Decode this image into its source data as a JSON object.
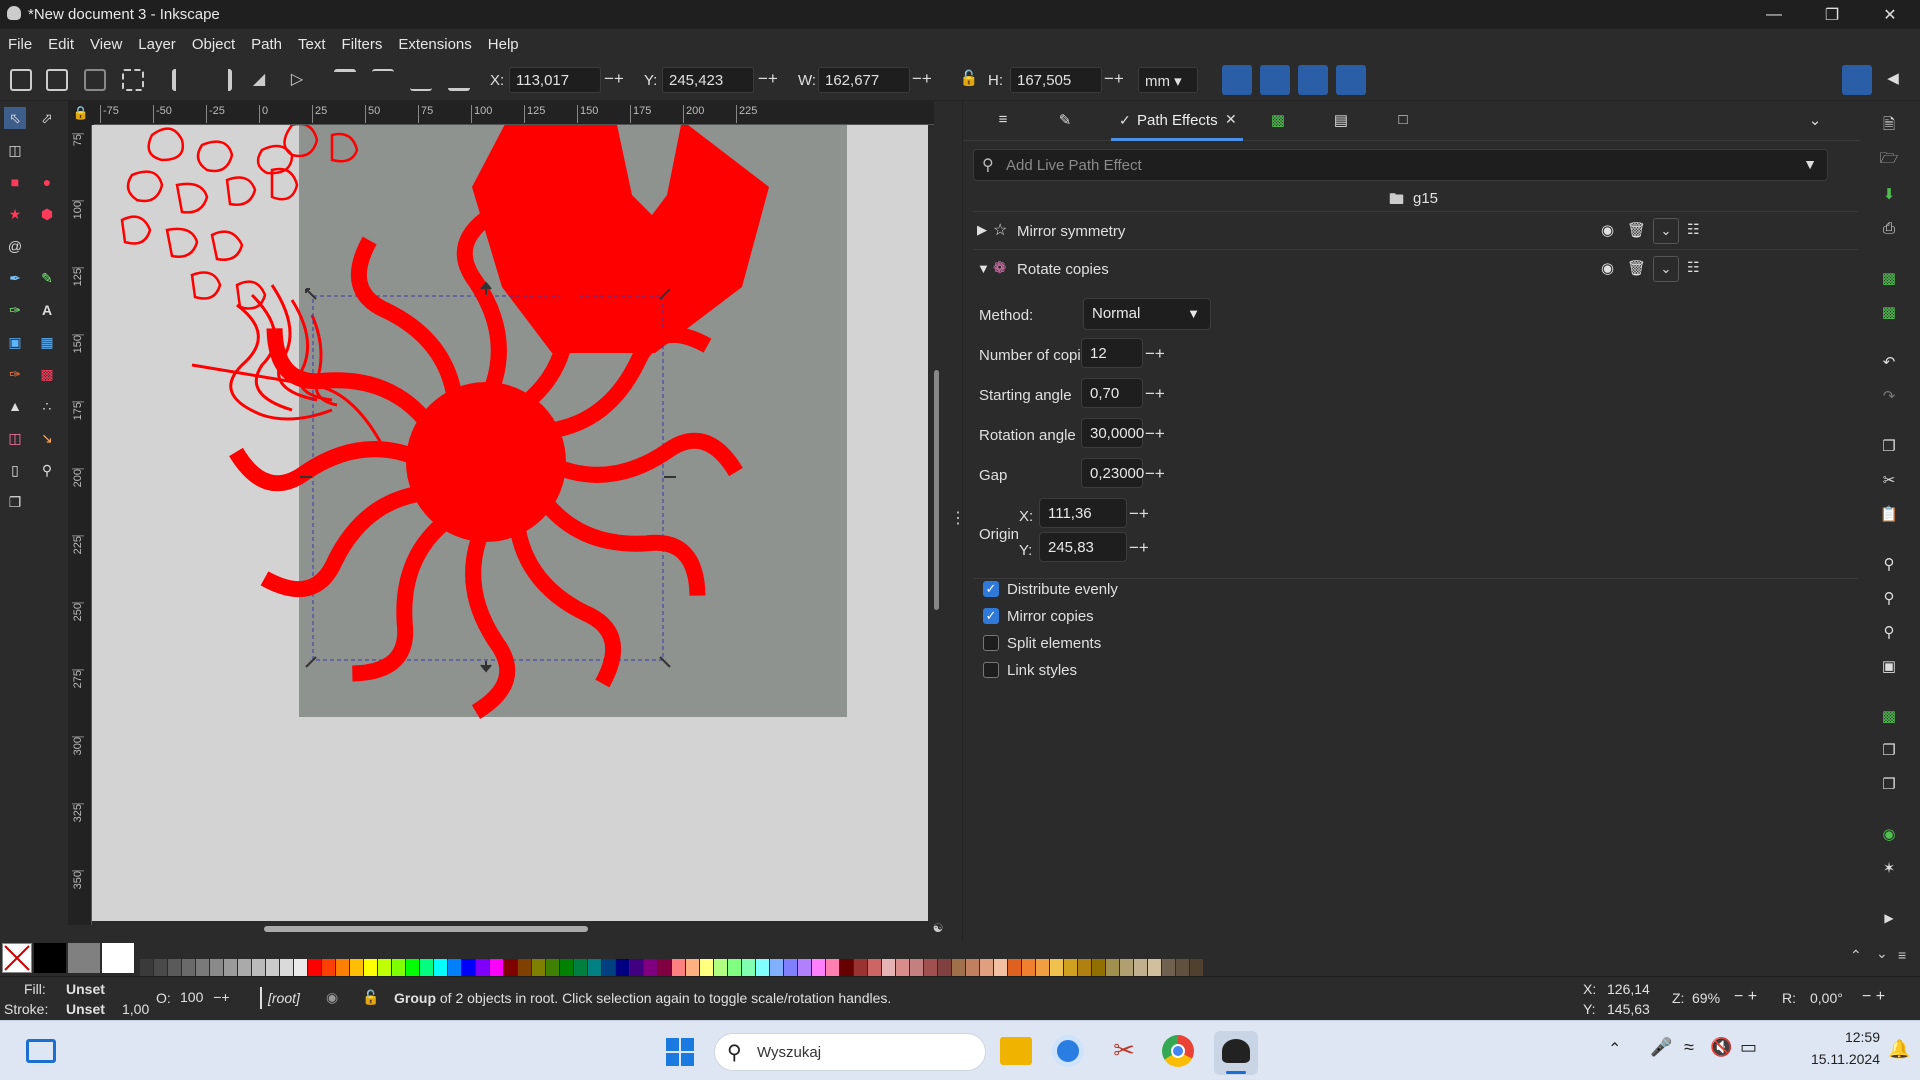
{
  "window": {
    "title": "*New document 3 - Inkscape"
  },
  "menu": [
    "File",
    "Edit",
    "View",
    "Layer",
    "Object",
    "Path",
    "Text",
    "Filters",
    "Extensions",
    "Help"
  ],
  "toolbar": {
    "x_label": "X:",
    "x_value": "113,017",
    "y_label": "Y:",
    "y_value": "245,423",
    "w_label": "W:",
    "w_value": "162,677",
    "h_label": "H:",
    "h_value": "167,505",
    "unit": "mm"
  },
  "ruler": {
    "top_ticks": [
      "-75",
      "-50",
      "-25",
      "0",
      "25",
      "50",
      "75",
      "100",
      "125",
      "150",
      "175",
      "200",
      "225"
    ],
    "left_ticks": [
      "75",
      "100",
      "125",
      "150",
      "175",
      "200",
      "225",
      "250",
      "275",
      "300",
      "325",
      "350"
    ]
  },
  "panel": {
    "tab_active": "Path Effects",
    "search_placeholder": "Add Live Path Effect",
    "object_name": "g15",
    "effects": [
      {
        "name": "Mirror symmetry"
      },
      {
        "name": "Rotate copies"
      }
    ],
    "params": {
      "method_label": "Method:",
      "method_value": "Normal",
      "copies_label": "Number of copies",
      "copies_value": "12",
      "start_label": "Starting angle",
      "start_value": "0,70",
      "rot_label": "Rotation angle",
      "rot_value": "30,0000",
      "gap_label": "Gap",
      "gap_value": "0,23000",
      "origin_label": "Origin",
      "ox_label": "X:",
      "ox_value": "111,36",
      "oy_label": "Y:",
      "oy_value": "245,83"
    },
    "checks": [
      {
        "label": "Distribute evenly",
        "checked": true
      },
      {
        "label": "Mirror copies",
        "checked": true
      },
      {
        "label": "Split elements",
        "checked": false
      },
      {
        "label": "Link styles",
        "checked": false
      }
    ]
  },
  "status": {
    "fill_label": "Fill:",
    "fill_value": "Unset",
    "stroke_label": "Stroke:",
    "stroke_value": "Unset",
    "stroke_width": "1,00",
    "opacity_label": "O:",
    "opacity_value": "100",
    "layer": "[root]",
    "message_bold": "Group",
    "message_rest": " of 2 objects in root. Click selection again to toggle scale/rotation handles.",
    "cx_label": "X:",
    "cx_value": "126,14",
    "cy_label": "Y:",
    "cy_value": "145,63",
    "zoom_label": "Z:",
    "zoom_value": "69%",
    "rot_label": "R:",
    "rot_value": "0,00°"
  },
  "taskbar": {
    "search_placeholder": "Wyszukaj",
    "time": "12:59",
    "date": "15.11.2024"
  },
  "palette": [
    "#ff0000",
    "#ff4000",
    "#ff8000",
    "#ffbf00",
    "#ffff00",
    "#bfff00",
    "#80ff00",
    "#00ff00",
    "#00ff80",
    "#00ffff",
    "#0080ff",
    "#0000ff",
    "#8000ff",
    "#ff00ff"
  ]
}
